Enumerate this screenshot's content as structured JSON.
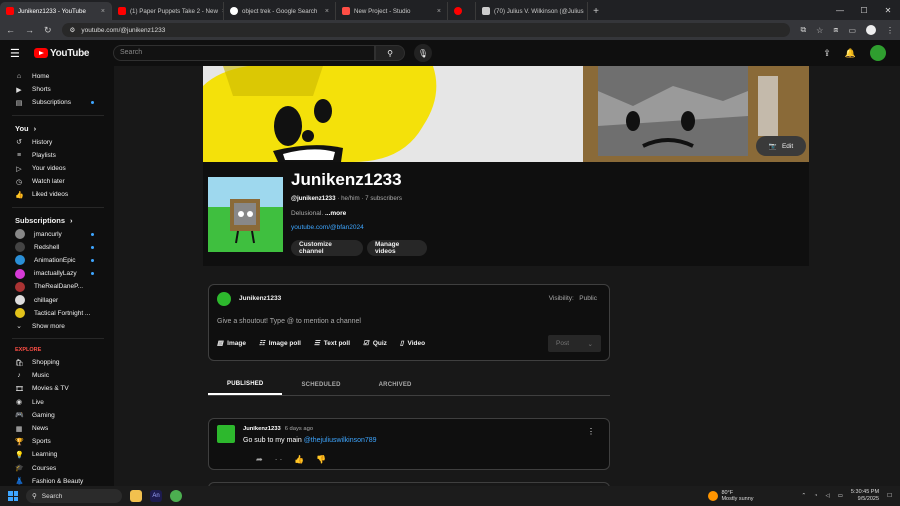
{
  "browser": {
    "tabs": [
      {
        "title": "Junikenz1233 - YouTube",
        "color": "#ff0000",
        "active": true
      },
      {
        "title": "(1) Paper Puppets Take 2 - New",
        "color": "#ff0000"
      },
      {
        "title": "object trek - Google Search",
        "color": "#4285f4"
      },
      {
        "title": "New Project - Studio",
        "color": "#ff4e45"
      },
      {
        "title": "",
        "color": "#ff0000"
      },
      {
        "title": "(70) Julius V. Wilkinson (@Julius",
        "color": "#cccccc"
      }
    ],
    "url": "youtube.com/@junikenz1233"
  },
  "header": {
    "logo_text": "YouTube",
    "search_placeholder": "Search"
  },
  "sidebar": {
    "main": [
      {
        "label": "Home",
        "icon": "home-icon"
      },
      {
        "label": "Shorts",
        "icon": "shorts-icon"
      },
      {
        "label": "Subscriptions",
        "icon": "subscriptions-icon",
        "dot": true
      }
    ],
    "you_title": "You",
    "you": [
      {
        "label": "History",
        "icon": "history-icon"
      },
      {
        "label": "Playlists",
        "icon": "playlists-icon"
      },
      {
        "label": "Your videos",
        "icon": "your-videos-icon"
      },
      {
        "label": "Watch later",
        "icon": "watch-later-icon"
      },
      {
        "label": "Liked videos",
        "icon": "liked-videos-icon"
      }
    ],
    "subs_title": "Subscriptions",
    "subs": [
      {
        "label": "jmancurly",
        "color": "#888888",
        "dot": true
      },
      {
        "label": "Redshell",
        "color": "#444444",
        "dot": true
      },
      {
        "label": "AnimationEpic",
        "color": "#2a8fd6",
        "dot": true
      },
      {
        "label": "imactuallyLazy",
        "color": "#d63ad6",
        "dot": true
      },
      {
        "label": "TheRealDaneP...",
        "color": "#aa3333",
        "dot": false
      },
      {
        "label": "chillager",
        "color": "#dddddd",
        "dot": false
      },
      {
        "label": "Tactical Fortnight ...",
        "color": "#e2c21a",
        "dot": false
      }
    ],
    "show_more": "Show more",
    "explore_title": "EXPLORE",
    "explore": [
      {
        "label": "Shopping",
        "icon": "shopping-icon"
      },
      {
        "label": "Music",
        "icon": "music-icon"
      },
      {
        "label": "Movies & TV",
        "icon": "movies-icon"
      },
      {
        "label": "Live",
        "icon": "live-icon"
      },
      {
        "label": "Gaming",
        "icon": "gaming-icon"
      },
      {
        "label": "News",
        "icon": "news-icon"
      },
      {
        "label": "Sports",
        "icon": "sports-icon"
      },
      {
        "label": "Learning",
        "icon": "learning-icon"
      },
      {
        "label": "Courses",
        "icon": "courses-icon"
      },
      {
        "label": "Fashion & Beauty",
        "icon": "fashion-icon"
      }
    ]
  },
  "banner": {
    "edit_label": "Edit"
  },
  "channel": {
    "name": "Junikenz1233",
    "handle": "@junikenz1233",
    "pronouns": "· he/him ·",
    "subscribers": "7 subscribers",
    "description": "Delusional.",
    "more": "...more",
    "link": "youtube.com/@bfan2024",
    "customize": "Customize channel",
    "manage": "Manage videos"
  },
  "composer": {
    "name": "Junikenz1233",
    "visibility_label": "Visibility:",
    "visibility_value": "Public",
    "placeholder": "Give a shoutout! Type @ to mention a channel",
    "tools": [
      {
        "label": "Image",
        "icon": "image-icon"
      },
      {
        "label": "Image poll",
        "icon": "image-poll-icon"
      },
      {
        "label": "Text poll",
        "icon": "text-poll-icon"
      },
      {
        "label": "Quiz",
        "icon": "quiz-icon"
      },
      {
        "label": "Video",
        "icon": "video-icon"
      }
    ],
    "post_label": "Post"
  },
  "post_tabs": [
    "PUBLISHED",
    "SCHEDULED",
    "ARCHIVED"
  ],
  "post": {
    "author": "Junikenz1233",
    "time": "6 days ago",
    "text": "Go sub to my main",
    "mention": "@thejuliuswilkinson789"
  },
  "taskbar": {
    "search": "Search",
    "weather_temp": "80°F",
    "weather_desc": "Mostly sunny",
    "time": "5:30:45 PM",
    "date": "9/5/2025"
  }
}
